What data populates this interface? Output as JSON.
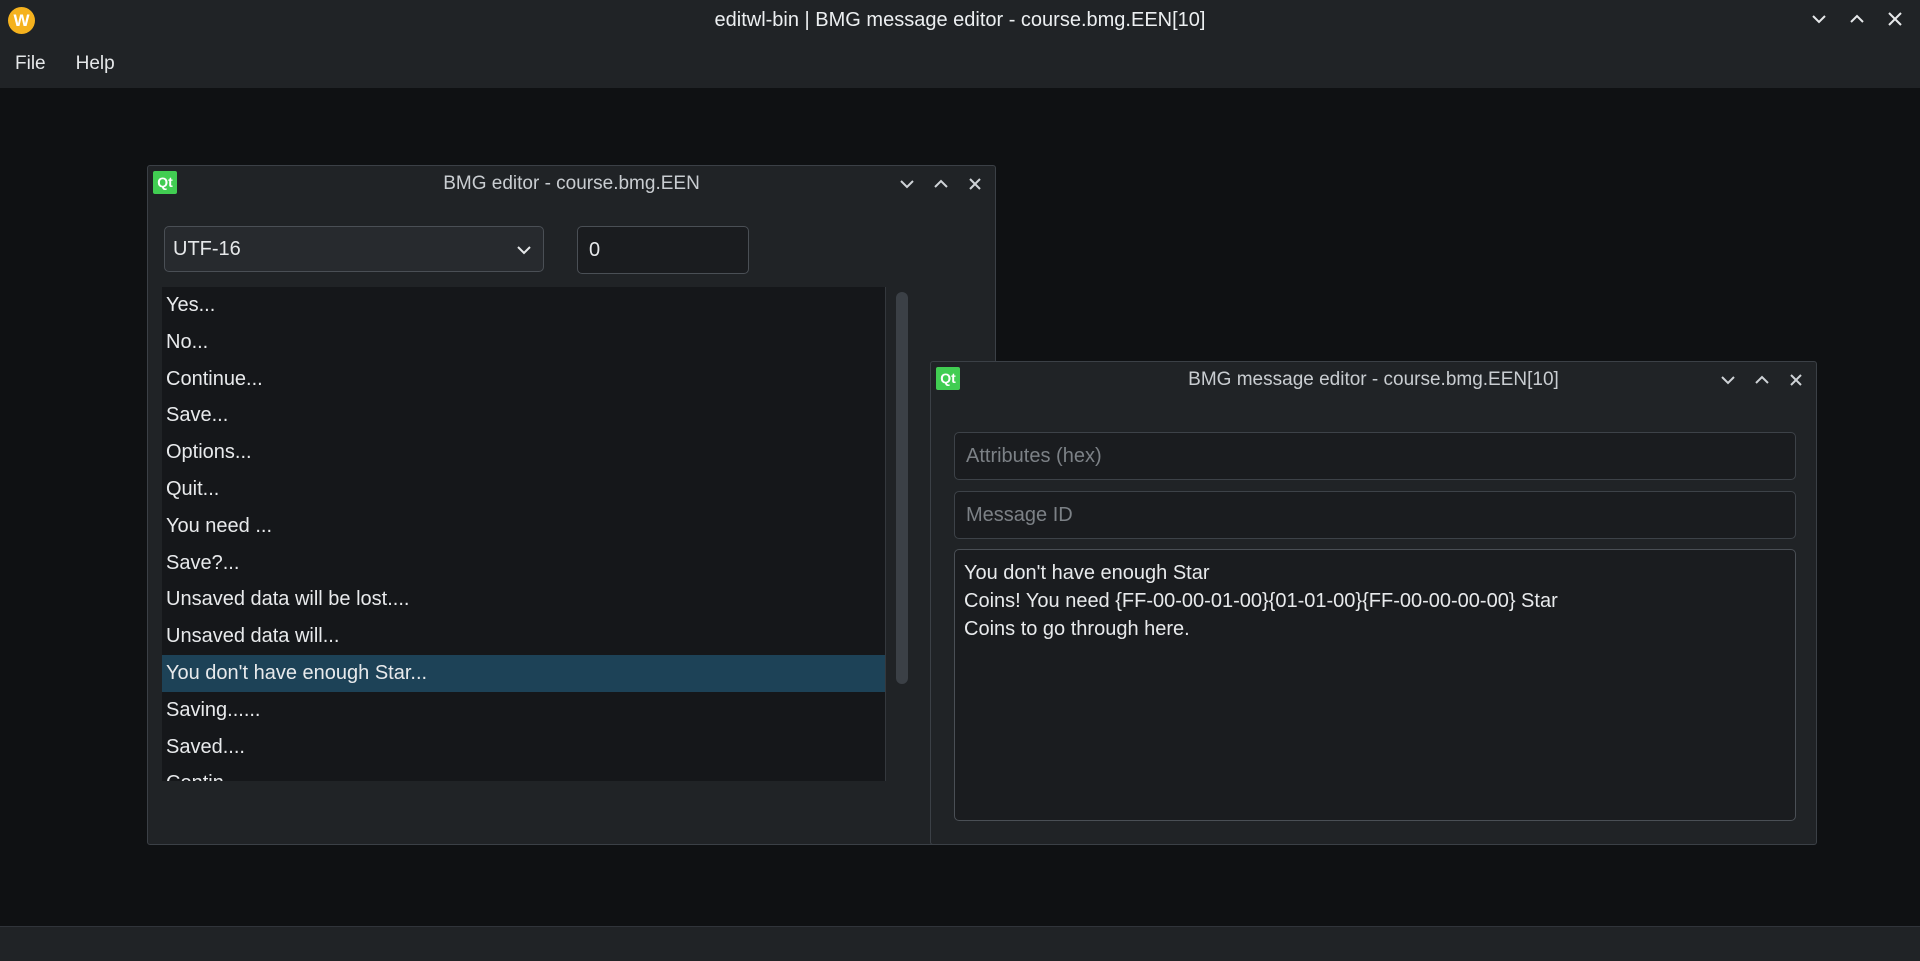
{
  "app": {
    "logo_letter": "W",
    "title": "editwl-bin | BMG message editor - course.bmg.EEN[10]"
  },
  "menu": [
    "File",
    "Help"
  ],
  "bmg_editor": {
    "icon_label": "Qt",
    "title": "BMG editor - course.bmg.EEN",
    "encoding": "UTF-16",
    "index_value": "0",
    "items": [
      "Yes...",
      "No...",
      "Continue...",
      "Save...",
      "Options...",
      "Quit...",
      "You need ...",
      "Save?...",
      "Unsaved data will be lost....",
      "Unsaved data will...",
      "You don't have enough Star...",
      "Saving......",
      "Saved....",
      "Contin..."
    ],
    "selected_index": 10
  },
  "message_editor": {
    "icon_label": "Qt",
    "title": "BMG message editor - course.bmg.EEN[10]",
    "attributes_placeholder": "Attributes (hex)",
    "message_id_placeholder": "Message ID",
    "message_text": "You don't have enough Star\nCoins! You need {FF-00-00-01-00}{01-01-00}{FF-00-00-00-00} Star\nCoins to go through here."
  }
}
